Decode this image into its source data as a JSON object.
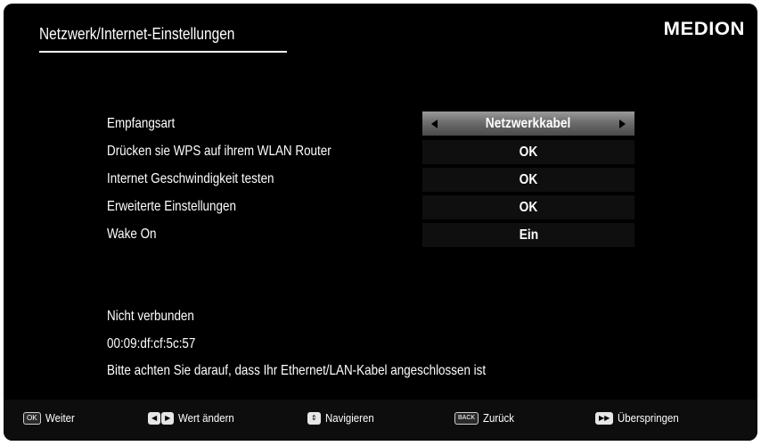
{
  "header": {
    "title": "Netzwerk/Internet-Einstellungen",
    "brand": "MEDION"
  },
  "settings": [
    {
      "label": "Empfangsart",
      "value": "Netzwerkkabel",
      "selected": true
    },
    {
      "label": "Drücken sie WPS auf ihrem WLAN Router",
      "value": "OK"
    },
    {
      "label": "Internet Geschwindigkeit testen",
      "value": "OK"
    },
    {
      "label": "Erweiterte Einstellungen",
      "value": "OK"
    },
    {
      "label": "Wake On",
      "value": "Ein"
    }
  ],
  "status": {
    "connection": "Nicht verbunden",
    "mac": "00:09:df:cf:5c:57",
    "message": "Bitte achten Sie darauf, dass Ihr Ethernet/LAN-Kabel angeschlossen ist"
  },
  "footer": {
    "ok_key": "OK",
    "ok_label": "Weiter",
    "lr_label": "Wert ändern",
    "ud_label": "Navigieren",
    "back_key": "BACK",
    "back_label": "Zurück",
    "skip_label": "Überspringen"
  },
  "colors": {
    "background": "#000000",
    "selected_value": "#7a7a7a",
    "text": "#ffffff"
  }
}
